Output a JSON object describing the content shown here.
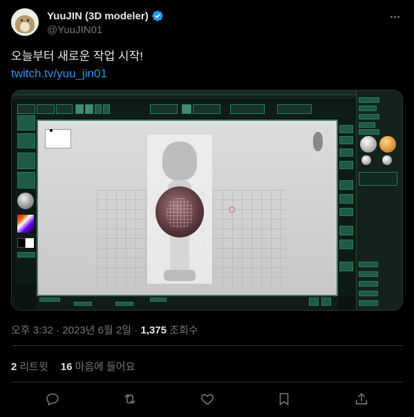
{
  "author": {
    "display_name": "YuuJIN (3D modeler)",
    "handle": "@YuuJIN01",
    "verified": true
  },
  "tweet": {
    "text": "오늘부터 새로운 작업 시작!",
    "link": "twitch.tv/yuu_jin01"
  },
  "media": {
    "description_icon": "zbrush-screenshot"
  },
  "meta": {
    "time": "오후 3:32",
    "separator": "·",
    "date": "2023년 6월 2일",
    "views_count": "1,375",
    "views_label": "조회수"
  },
  "stats": {
    "retweets_count": "2",
    "retweets_label": "리트윗",
    "likes_count": "16",
    "likes_label": "마음에 들어요"
  },
  "actions": [
    "reply-icon",
    "retweet-icon",
    "like-icon",
    "bookmark-icon",
    "share-icon"
  ],
  "colors": {
    "background": "#000000",
    "text": "#e7e9ea",
    "secondary": "#71767b",
    "link": "#1d9bf0",
    "border": "#2f3336"
  }
}
